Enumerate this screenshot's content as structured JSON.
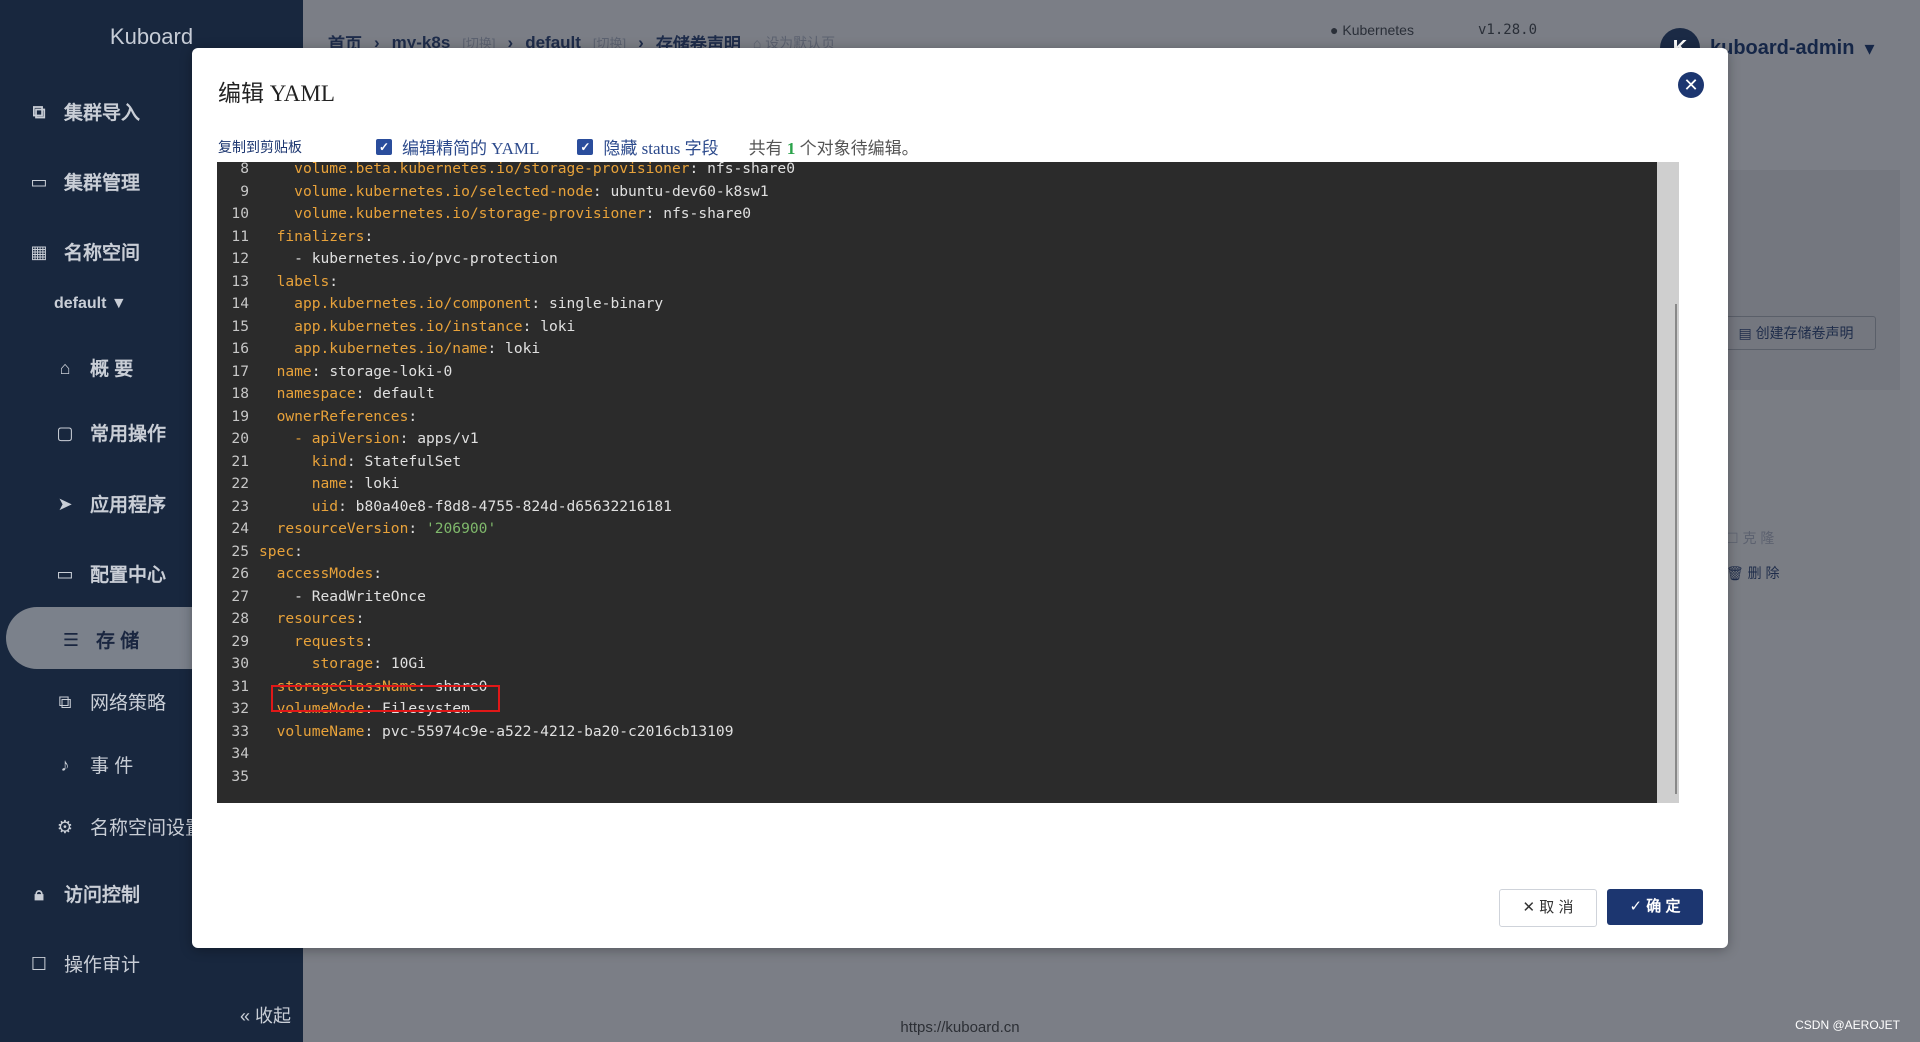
{
  "app": {
    "brand": "Kuboard",
    "url_footer": "https://kuboard.cn",
    "watermark": "CSDN @AEROJET"
  },
  "sidebar": {
    "items": [
      {
        "label": "集群导入",
        "icon": "cluster-import-icon"
      },
      {
        "label": "集群管理",
        "icon": "cluster-manage-icon"
      },
      {
        "label": "名称空间",
        "icon": "grid-icon"
      },
      {
        "label": "概 要",
        "icon": "home-icon"
      },
      {
        "label": "常用操作",
        "icon": "folder-icon"
      },
      {
        "label": "应用程序",
        "icon": "send-icon"
      },
      {
        "label": "配置中心",
        "icon": "config-icon"
      },
      {
        "label": "存 储",
        "icon": "database-icon"
      },
      {
        "label": "网络策略",
        "icon": "network-icon"
      },
      {
        "label": "事 件",
        "icon": "bell-icon"
      },
      {
        "label": "名称空间设置",
        "icon": "gear-icon"
      },
      {
        "label": "访问控制",
        "icon": "lock-icon"
      },
      {
        "label": "操作审计",
        "icon": "audit-icon"
      }
    ],
    "namespace": "default",
    "collapse_label": "收起"
  },
  "header": {
    "breadcrumb": [
      {
        "label": "首页"
      },
      {
        "label": "my-k8s",
        "tag": "[切换]"
      },
      {
        "label": "default",
        "tag": "[切换]"
      },
      {
        "label": "存储卷声明"
      }
    ],
    "set_default": "设为默认页",
    "k8s_label": "Kubernetes",
    "k8s_version": "v1.28.0",
    "avatar_letter": "K",
    "user": "kuboard-admin"
  },
  "background": {
    "create_pvc": "创建存储卷声明",
    "clone": "克 隆",
    "delete": "删 除"
  },
  "modal": {
    "title": "编辑 YAML",
    "copy_label": "复制到剪贴板",
    "opt_simplified": "编辑精简的 YAML",
    "opt_hide_status": "隐藏 status 字段",
    "summary_prefix": "共有",
    "summary_count": "1",
    "summary_suffix": "个对象待编辑。",
    "cancel_label": "取 消",
    "ok_label": "确 定",
    "yaml_lines": [
      {
        "n": "8",
        "indent": "    ",
        "key": "volume.beta.kubernetes.io/storage-provisioner",
        "val": "nfs-share0"
      },
      {
        "n": "9",
        "indent": "    ",
        "key": "volume.kubernetes.io/selected-node",
        "val": "ubuntu-dev60-k8sw1"
      },
      {
        "n": "10",
        "indent": "    ",
        "key": "volume.kubernetes.io/storage-provisioner",
        "val": "nfs-share0"
      },
      {
        "n": "11",
        "indent": "  ",
        "key": "finalizers",
        "val": ""
      },
      {
        "n": "12",
        "indent": "    - ",
        "key": "",
        "val": "kubernetes.io/pvc-protection"
      },
      {
        "n": "13",
        "indent": "  ",
        "key": "labels",
        "val": ""
      },
      {
        "n": "14",
        "indent": "    ",
        "key": "app.kubernetes.io/component",
        "val": "single-binary"
      },
      {
        "n": "15",
        "indent": "    ",
        "key": "app.kubernetes.io/instance",
        "val": "loki"
      },
      {
        "n": "16",
        "indent": "    ",
        "key": "app.kubernetes.io/name",
        "val": "loki"
      },
      {
        "n": "17",
        "indent": "  ",
        "key": "name",
        "val": "storage-loki-0"
      },
      {
        "n": "18",
        "indent": "  ",
        "key": "namespace",
        "val": "default"
      },
      {
        "n": "19",
        "indent": "  ",
        "key": "ownerReferences",
        "val": ""
      },
      {
        "n": "20",
        "indent": "    - ",
        "key": "apiVersion",
        "val": "apps/v1"
      },
      {
        "n": "21",
        "indent": "      ",
        "key": "kind",
        "val": "StatefulSet"
      },
      {
        "n": "22",
        "indent": "      ",
        "key": "name",
        "val": "loki"
      },
      {
        "n": "23",
        "indent": "      ",
        "key": "uid",
        "val": "b80a40e8-f8d8-4755-824d-d65632216181"
      },
      {
        "n": "24",
        "indent": "  ",
        "key": "resourceVersion",
        "val": "'206900'",
        "str": true
      },
      {
        "n": "25",
        "indent": "",
        "key": "spec",
        "val": ""
      },
      {
        "n": "26",
        "indent": "  ",
        "key": "accessModes",
        "val": ""
      },
      {
        "n": "27",
        "indent": "    - ",
        "key": "",
        "val": "ReadWriteOnce"
      },
      {
        "n": "28",
        "indent": "  ",
        "key": "resources",
        "val": ""
      },
      {
        "n": "29",
        "indent": "    ",
        "key": "requests",
        "val": ""
      },
      {
        "n": "30",
        "indent": "      ",
        "key": "storage",
        "val": "10Gi"
      },
      {
        "n": "31",
        "indent": "  ",
        "key": "storageClassName",
        "val": "share0"
      },
      {
        "n": "32",
        "indent": "  ",
        "key": "volumeMode",
        "val": "Filesystem"
      },
      {
        "n": "33",
        "indent": "  ",
        "key": "volumeName",
        "val": "pvc-55974c9e-a522-4212-ba20-c2016cb13109"
      },
      {
        "n": "34",
        "indent": "",
        "key": "",
        "val": ""
      },
      {
        "n": "35",
        "indent": "",
        "key": "",
        "val": ""
      }
    ]
  },
  "colors": {
    "sidebar_bg": "#18273e",
    "primary": "#1c3670",
    "yaml_key": "#e8a23a",
    "yaml_string": "#7fb86b",
    "highlight_box": "#e01818"
  }
}
